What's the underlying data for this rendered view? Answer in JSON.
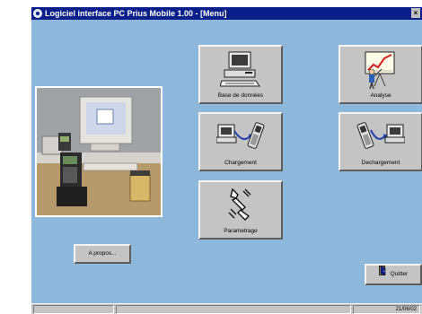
{
  "window": {
    "title": "Logiciel interface PC Prius Mobile 1.00 - [Menu]",
    "close_glyph": "×"
  },
  "tiles": {
    "base": {
      "label": "Base de données",
      "icon": "computer-icon"
    },
    "analyse": {
      "label": "Analyse",
      "icon": "chart-presenter-icon"
    },
    "chargement": {
      "label": "Chargement",
      "icon": "upload-to-terminal-icon"
    },
    "dechargement": {
      "label": "Dechargement",
      "icon": "download-to-pc-icon"
    },
    "parametrage": {
      "label": "Parametrage",
      "icon": "wrench-icon"
    }
  },
  "buttons": {
    "apropos": "A propos...",
    "quitter": "Quitter"
  },
  "statusbar": {
    "date": "21/06/02"
  },
  "colors": {
    "background": "#8db8dc",
    "titlebar": "#0a1f8a",
    "button_face": "#c4c4c4"
  }
}
